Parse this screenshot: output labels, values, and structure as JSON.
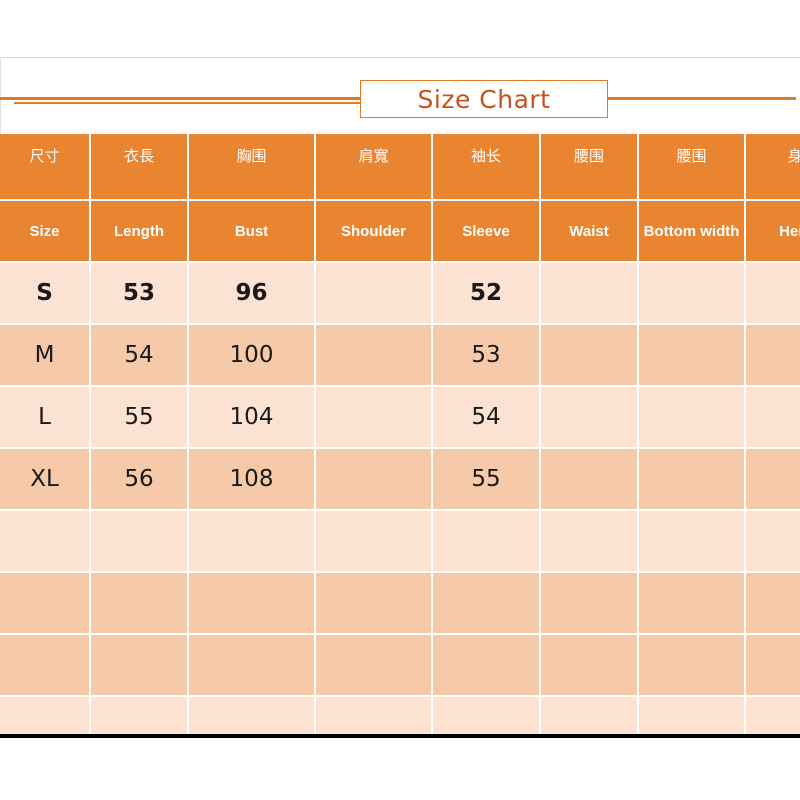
{
  "title": {
    "text": "Size Chart",
    "accent_color": "#C4541B",
    "rule_color": "#E17B26"
  },
  "colors": {
    "header_orange": "#E98430",
    "row_light": "#FBE2D2",
    "row_dark": "#F6C9A8",
    "grid_line": "#FFFFFF",
    "bottom_border": "#000000",
    "text": "#1A1A1A",
    "header_text": "#FFFFFF"
  },
  "table": {
    "headers_cn": [
      "尺寸",
      "衣長",
      "胸围",
      "肩寬",
      "袖长",
      "腰围",
      "腰围",
      "身高"
    ],
    "headers_en": [
      "Size",
      "Length",
      "Bust",
      "Shoulder",
      "Sleeve",
      "Waist",
      "Bottom width",
      "Height"
    ],
    "rows": [
      {
        "shade": "light",
        "emphasis": true,
        "cells": [
          "S",
          "53",
          "96",
          "",
          "52",
          "",
          "",
          ""
        ]
      },
      {
        "shade": "dark",
        "emphasis": false,
        "cells": [
          "M",
          "54",
          "100",
          "",
          "53",
          "",
          "",
          ""
        ]
      },
      {
        "shade": "light",
        "emphasis": false,
        "cells": [
          "L",
          "55",
          "104",
          "",
          "54",
          "",
          "",
          ""
        ]
      },
      {
        "shade": "dark",
        "emphasis": false,
        "cells": [
          "XL",
          "56",
          "108",
          "",
          "55",
          "",
          "",
          ""
        ]
      },
      {
        "shade": "light",
        "emphasis": false,
        "cells": [
          "",
          "",
          "",
          "",
          "",
          "",
          "",
          ""
        ]
      },
      {
        "shade": "dark",
        "emphasis": false,
        "cells": [
          "",
          "",
          "",
          "",
          "",
          "",
          "",
          ""
        ]
      },
      {
        "shade": "dark",
        "emphasis": false,
        "cells": [
          "",
          "",
          "",
          "",
          "",
          "",
          "",
          ""
        ]
      },
      {
        "shade": "light",
        "emphasis": false,
        "cells": [
          "",
          "",
          "",
          "",
          "",
          "",
          "",
          ""
        ]
      }
    ]
  }
}
